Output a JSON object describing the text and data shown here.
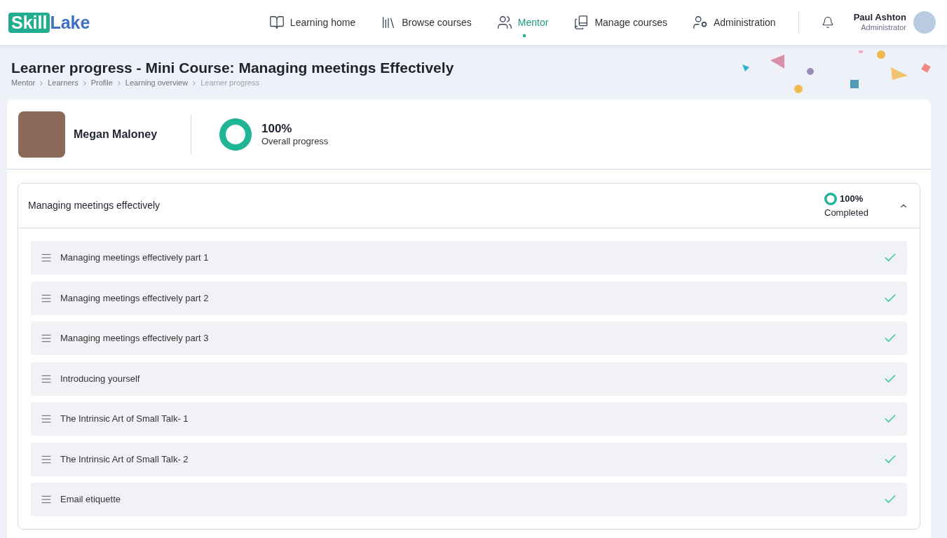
{
  "logo": {
    "part_1": "Skill",
    "part_2": "Lake"
  },
  "nav": [
    {
      "label": "Learning home",
      "selected": false
    },
    {
      "label": "Browse courses",
      "selected": false
    },
    {
      "label": "Mentor",
      "selected": true
    },
    {
      "label": "Manage courses",
      "selected": false
    },
    {
      "label": "Administration",
      "selected": false
    }
  ],
  "user": {
    "name": "Paul Ashton",
    "role": "Administrator"
  },
  "page": {
    "title": "Learner progress - Mini Course: Managing meetings Effectively",
    "breadcrumbs": [
      "Mentor",
      "Learners",
      "Profile",
      "Learning overview",
      "Learner progress"
    ]
  },
  "learner": {
    "name": "Megan Maloney",
    "progress": {
      "value": "100%",
      "label": "Overall progress",
      "level": 1
    }
  },
  "section": {
    "title": "Managing meetings effectively",
    "expanded": true,
    "progress": {
      "value": "100%",
      "label": "Completed",
      "level": 1
    },
    "lessons": [
      {
        "title": "Managing meetings effectively part 1",
        "completed": true
      },
      {
        "title": "Managing meetings effectively part 2",
        "completed": true
      },
      {
        "title": "Managing meetings effectively part 3",
        "completed": true
      },
      {
        "title": "Introducing yourself",
        "completed": true
      },
      {
        "title": "The Intrinsic Art of Small Talk- 1",
        "completed": true
      },
      {
        "title": "The Intrinsic Art of Small Talk- 2",
        "completed": true
      },
      {
        "title": "Email etiquette",
        "completed": true
      }
    ]
  }
}
